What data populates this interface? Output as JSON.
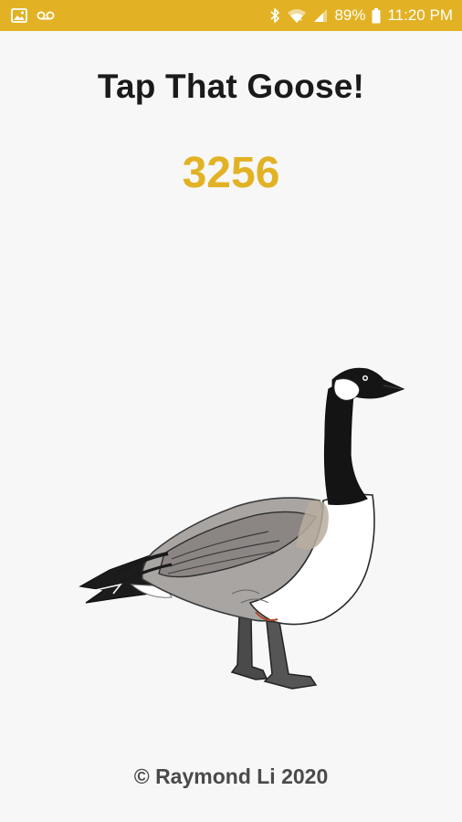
{
  "status_bar": {
    "background": "#e2b224",
    "left_icons": [
      "image-icon",
      "voicemail-icon"
    ],
    "right_icons": [
      "bluetooth-icon",
      "wifi-icon",
      "cell-signal-icon",
      "battery-icon"
    ],
    "battery": "89%",
    "time": "11:20 PM"
  },
  "app": {
    "title": "Tap That Goose!",
    "score": "3256",
    "accent_color": "#e2b224",
    "goose_icon": "canada-goose-image",
    "footer": "© Raymond Li 2020"
  }
}
